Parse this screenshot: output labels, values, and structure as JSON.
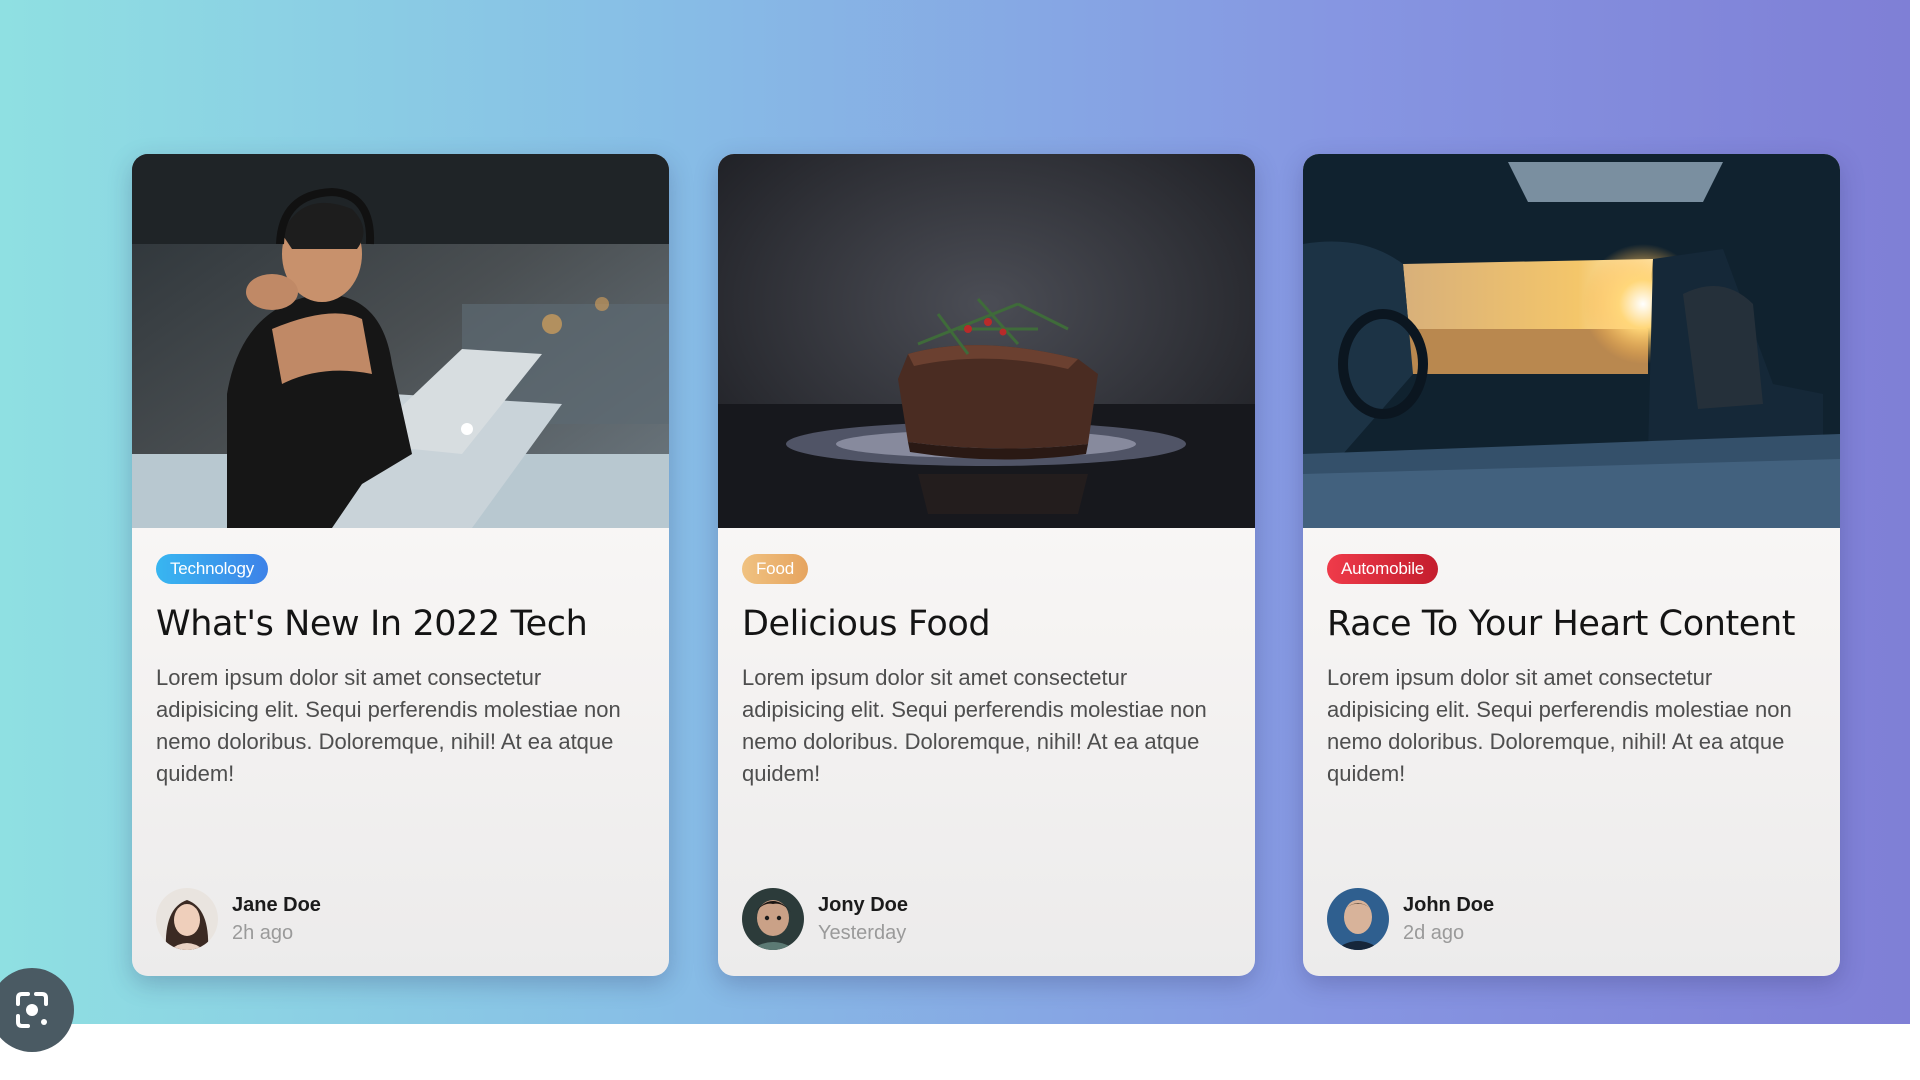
{
  "cards": [
    {
      "tag": "Technology",
      "tag_color": "#3a9df0",
      "title": "What's New In 2022 Tech",
      "text": "Lorem ipsum dolor sit amet consectetur adipisicing elit. Sequi perferendis molestiae non nemo doloribus. Doloremque, nihil! At ea atque quidem!",
      "author": {
        "name": "Jane Doe",
        "time": "2h ago"
      }
    },
    {
      "tag": "Food",
      "tag_color": "#eab06d",
      "title": "Delicious Food",
      "text": "Lorem ipsum dolor sit amet consectetur adipisicing elit. Sequi perferendis molestiae non nemo doloribus. Doloremque, nihil! At ea atque quidem!",
      "author": {
        "name": "Jony Doe",
        "time": "Yesterday"
      }
    },
    {
      "tag": "Automobile",
      "tag_color": "#dc2e3d",
      "title": "Race To Your Heart Content",
      "text": "Lorem ipsum dolor sit amet consectetur adipisicing elit. Sequi perferendis molestiae non nemo doloribus. Doloremque, nihil! At ea atque quidem!",
      "author": {
        "name": "John Doe",
        "time": "2d ago"
      }
    }
  ],
  "background_gradient": [
    "#8fe0e2",
    "#7f7fd6"
  ],
  "overlay_button_icon": "lens-search-icon"
}
